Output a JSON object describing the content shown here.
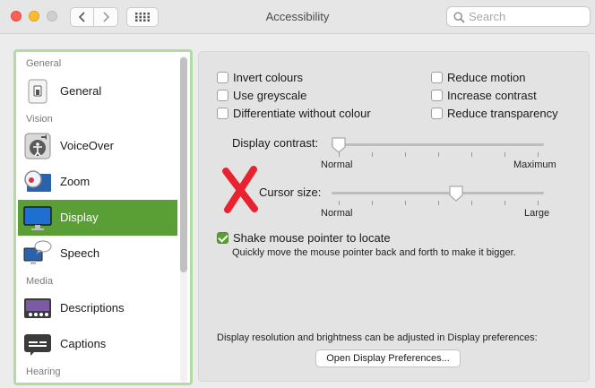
{
  "window": {
    "title": "Accessibility"
  },
  "toolbar": {
    "search_placeholder": "Search"
  },
  "sidebar": {
    "sections": [
      "General",
      "Vision",
      "Media",
      "Hearing"
    ],
    "items": [
      {
        "label": "General",
        "icon": "general-icon"
      },
      {
        "label": "VoiceOver",
        "icon": "voiceover-icon"
      },
      {
        "label": "Zoom",
        "icon": "zoom-icon"
      },
      {
        "label": "Display",
        "icon": "display-icon",
        "selected": true
      },
      {
        "label": "Speech",
        "icon": "speech-icon"
      },
      {
        "label": "Descriptions",
        "icon": "descriptions-icon"
      },
      {
        "label": "Captions",
        "icon": "captions-icon"
      }
    ]
  },
  "display": {
    "checkboxes_left": [
      {
        "label": "Invert colours",
        "checked": false
      },
      {
        "label": "Use greyscale",
        "checked": false
      },
      {
        "label": "Differentiate without colour",
        "checked": false
      }
    ],
    "checkboxes_right": [
      {
        "label": "Reduce motion",
        "checked": false
      },
      {
        "label": "Increase contrast",
        "checked": false
      },
      {
        "label": "Reduce transparency",
        "checked": false
      }
    ],
    "contrast": {
      "label": "Display contrast:",
      "min": "Normal",
      "max": "Maximum",
      "value": 0
    },
    "cursor": {
      "label": "Cursor size:",
      "min": "Normal",
      "max": "Large",
      "value": 0.59
    },
    "shake": {
      "label": "Shake mouse pointer to locate",
      "checked": true,
      "description": "Quickly move the mouse pointer back and forth to make it bigger."
    },
    "footer_note": "Display resolution and brightness can be adjusted in Display preferences:",
    "open_button": "Open Display Preferences..."
  },
  "colors": {
    "accent": "#5a9f35",
    "sidebar_border": "#b3dca5",
    "annotation": "#e8222e"
  }
}
